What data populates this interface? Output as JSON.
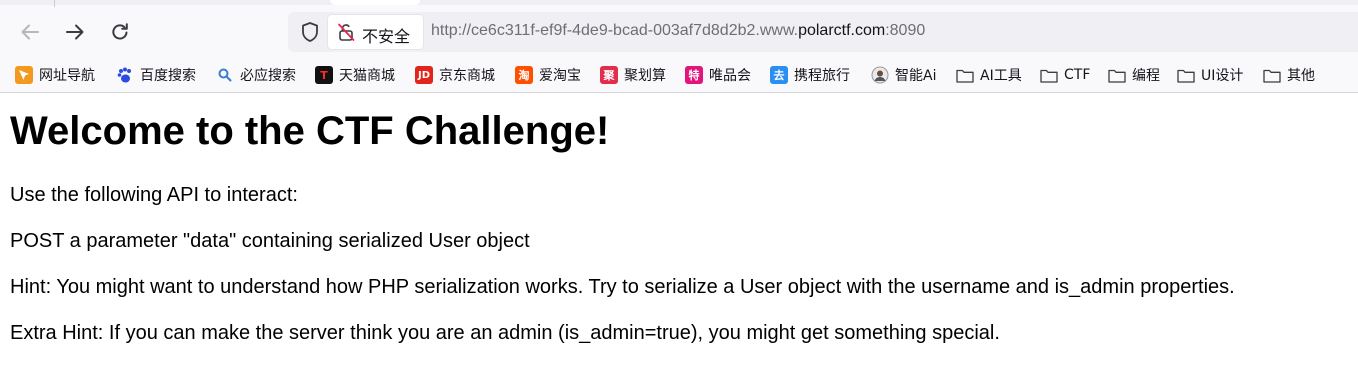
{
  "browser": {
    "security_label": "不安全",
    "url_prefix": "http://ce6c311f-ef9f-4de9-bcad-003af7d8d2b2.www.",
    "url_host": "polarctf.com",
    "url_suffix": ":8090"
  },
  "bookmarks": [
    {
      "label": "网址导航",
      "icon": "arrow-nav-icon",
      "color": "#f39a1e"
    },
    {
      "label": "百度搜索",
      "icon": "baidu-paw-icon",
      "color": "#2d4be0"
    },
    {
      "label": "必应搜索",
      "icon": "search-icon",
      "color": "#3a7bd5"
    },
    {
      "label": "天猫商城",
      "icon": "tmall-icon",
      "color": "#e0001b"
    },
    {
      "label": "京东商城",
      "icon": "jd-icon",
      "color": "#e1251b"
    },
    {
      "label": "爱淘宝",
      "icon": "taobao-icon",
      "color": "#ff5000"
    },
    {
      "label": "聚划算",
      "icon": "juhuasuan-icon",
      "color": "#e02e4c"
    },
    {
      "label": "唯品会",
      "icon": "vip-icon",
      "color": "#e4147d"
    },
    {
      "label": "携程旅行",
      "icon": "ctrip-icon",
      "color": "#2a8ef2"
    },
    {
      "label": "智能Ai",
      "icon": "avatar-icon",
      "color": "#777777"
    },
    {
      "label": "AI工具",
      "icon": "folder-icon"
    },
    {
      "label": "CTF",
      "icon": "folder-icon"
    },
    {
      "label": "编程",
      "icon": "folder-icon"
    },
    {
      "label": "UI设计",
      "icon": "folder-icon"
    },
    {
      "label": "其他",
      "icon": "folder-icon"
    }
  ],
  "page": {
    "heading": "Welcome to the CTF Challenge!",
    "line1": "Use the following API to interact:",
    "line2": "POST a parameter \"data\" containing serialized User object",
    "line3": "Hint: You might want to understand how PHP serialization works. Try to serialize a User object with the username and is_admin properties.",
    "line4": "Extra Hint: If you can make the server think you are an admin (is_admin=true), you might get something special."
  }
}
